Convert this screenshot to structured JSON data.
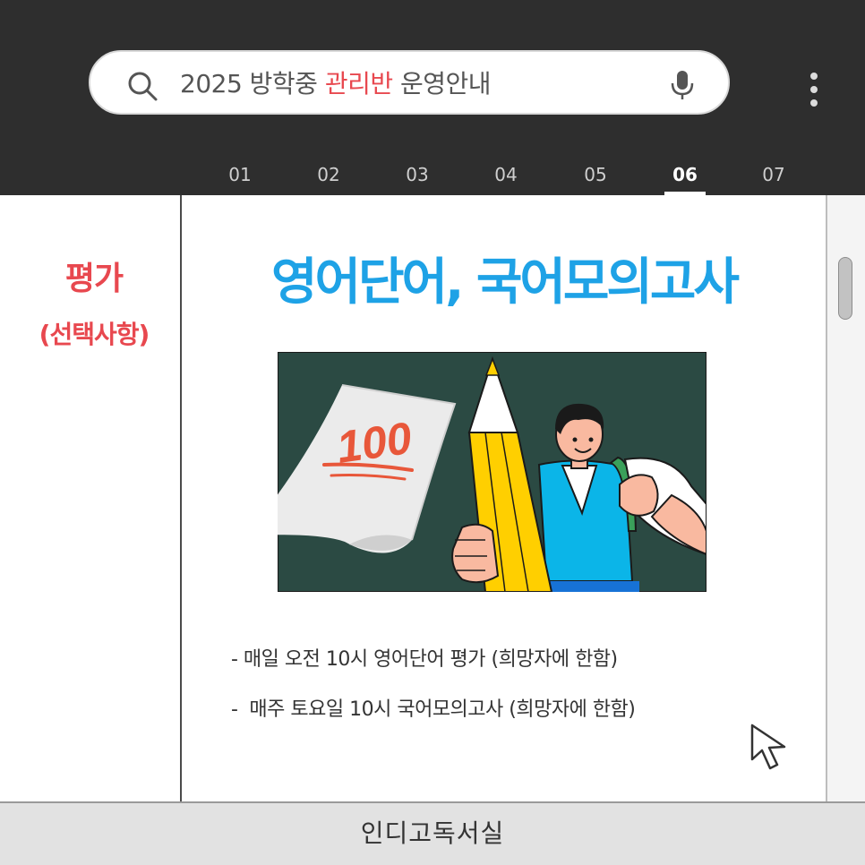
{
  "search": {
    "text_before": "2025 방학중 ",
    "text_highlight": "관리반",
    "text_after": " 운영안내",
    "highlight_color": "#e8484f",
    "icon": "search-icon",
    "mic_icon": "microphone-icon"
  },
  "menu_icon": "more-vertical-icon",
  "tabs": [
    {
      "label": "01",
      "active": false
    },
    {
      "label": "02",
      "active": false
    },
    {
      "label": "03",
      "active": false
    },
    {
      "label": "04",
      "active": false
    },
    {
      "label": "05",
      "active": false
    },
    {
      "label": "06",
      "active": true
    },
    {
      "label": "07",
      "active": false
    }
  ],
  "sidebar": {
    "label": "평가",
    "sublabel": "(선택사항)",
    "color": "#e8484f"
  },
  "main": {
    "title": "영어단어, 국어모의고사",
    "title_color": "#1ea2e6",
    "illustration": {
      "score_text": "100",
      "background_color": "#2b4a43"
    },
    "bullets": [
      "- 매일 오전 10시 영어단어 평가 (희망자에 한함)",
      "-  매주 토요일 10시 국어모의고사 (희망자에 한함)"
    ]
  },
  "cursor_icon": "mouse-pointer-icon",
  "footer": {
    "text": "인디고독서실"
  }
}
